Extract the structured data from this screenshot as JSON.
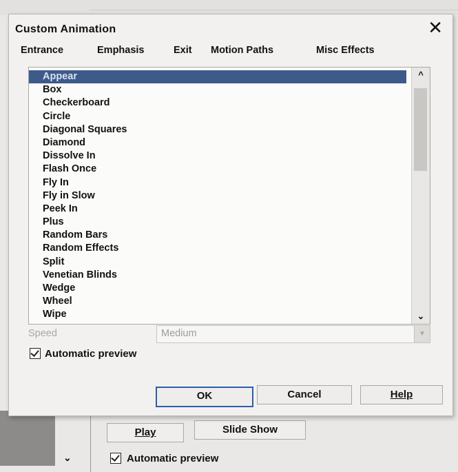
{
  "dialog": {
    "title": "Custom Animation",
    "close_glyph": "✕",
    "tabs": [
      {
        "label": "Entrance"
      },
      {
        "label": "Emphasis"
      },
      {
        "label": "Exit"
      },
      {
        "label": "Motion Paths"
      },
      {
        "label": "Misc Effects"
      }
    ],
    "active_tab": "Entrance",
    "effects": [
      "Appear",
      "Box",
      "Checkerboard",
      "Circle",
      "Diagonal Squares",
      "Diamond",
      "Dissolve In",
      "Flash Once",
      "Fly In",
      "Fly in Slow",
      "Peek In",
      "Plus",
      "Random Bars",
      "Random Effects",
      "Split",
      "Venetian Blinds",
      "Wedge",
      "Wheel",
      "Wipe"
    ],
    "selected_effect": "Appear",
    "scroll_up_glyph": "^",
    "scroll_down_glyph": "⌄",
    "speed_label": "Speed",
    "speed_value": "Medium",
    "automatic_preview_label": "Automatic preview",
    "automatic_preview_checked": true,
    "buttons": {
      "ok": "OK",
      "cancel": "Cancel",
      "help": "Help"
    }
  },
  "background_panel": {
    "play_label": "Play",
    "slide_show_label": "Slide Show",
    "automatic_preview_label": "Automatic preview",
    "automatic_preview_checked": true,
    "chevron_glyph": "⌄"
  },
  "colors": {
    "selection": "#3d5a8a",
    "dialog_bg": "#f2f1ef",
    "ok_border": "#2b5cb0"
  }
}
